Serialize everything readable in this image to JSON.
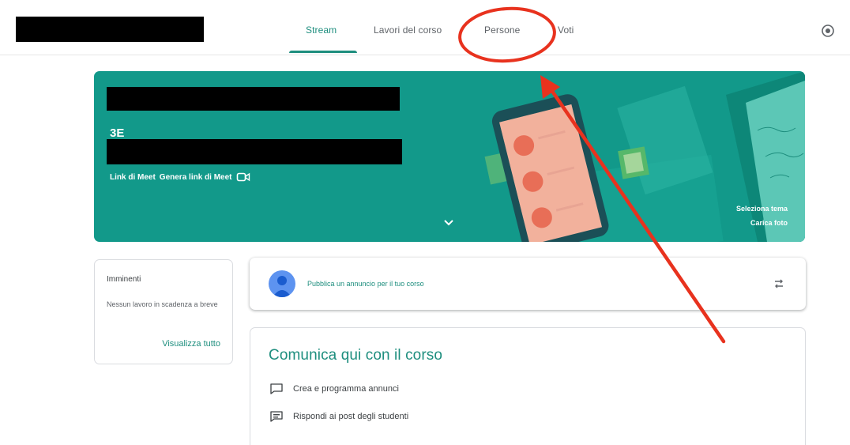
{
  "nav": {
    "tabs": [
      {
        "label": "Stream",
        "active": true
      },
      {
        "label": "Lavori del corso",
        "active": false
      },
      {
        "label": "Persone",
        "active": false
      },
      {
        "label": "Voti",
        "active": false
      }
    ],
    "settings_icon": "gear-icon"
  },
  "banner": {
    "section": "3E",
    "meet_link_label": "Link di Meet",
    "generate_meet_label": "Genera link di Meet",
    "select_theme_label": "Seleziona tema",
    "upload_photo_label": "Carica foto",
    "colors": {
      "background": "#12998a",
      "accent": "#1e8e7e"
    }
  },
  "upcoming": {
    "title": "Imminenti",
    "body": "Nessun lavoro in scadenza a breve",
    "link": "Visualizza tutto"
  },
  "announce": {
    "placeholder": "Pubblica un annuncio per il tuo corso"
  },
  "communicate": {
    "title": "Comunica qui con il corso",
    "items": [
      {
        "label": "Crea e programma annunci",
        "icon": "announcement-icon"
      },
      {
        "label": "Rispondi ai post degli studenti",
        "icon": "reply-comment-icon"
      }
    ]
  },
  "annotation": {
    "color": "#e8321e"
  }
}
